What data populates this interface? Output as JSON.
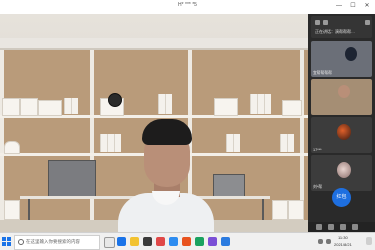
{
  "window": {
    "title": "H* *** *5",
    "controls": {
      "minimize": "—",
      "maximize": "☐",
      "close": "✕"
    }
  },
  "sidebar": {
    "header_title": "正在讲话：演帮帮帮…",
    "participants": [
      {
        "label": "宜帮帮帮帮"
      },
      {
        "label": ""
      },
      {
        "label": "17***"
      },
      {
        "label": "刘*帮"
      },
      {
        "label": ""
      }
    ],
    "raise_hand_label": "红包"
  },
  "taskbar": {
    "search_placeholder": "在这里输入你要搜索的内容",
    "time": "11:30",
    "date": "2021/8/21"
  },
  "colors": {
    "accent": "#1e6fe0",
    "sidebar_bg": "#2a2a2a",
    "taskbar_bg": "#f0f0f0"
  }
}
